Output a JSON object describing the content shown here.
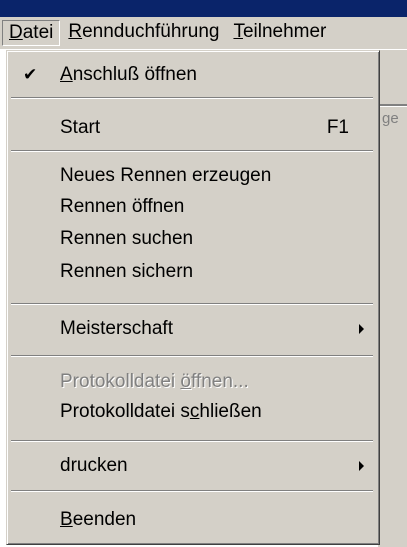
{
  "menubar": {
    "items": [
      {
        "prefix": "",
        "accel": "D",
        "rest": "atei"
      },
      {
        "prefix": "",
        "accel": "R",
        "rest": "ennduchführung"
      },
      {
        "prefix": "",
        "accel": "T",
        "rest": "eilnehmer"
      }
    ]
  },
  "background": {
    "fragment": "ge"
  },
  "menu": {
    "items": [
      {
        "prefix": "",
        "accel": "A",
        "rest": "nschluß öffnen",
        "checked": true
      },
      {
        "label": "Start",
        "shortcut": "F1"
      },
      {
        "label": "Neues Rennen erzeugen"
      },
      {
        "label": "Rennen öffnen"
      },
      {
        "label": "Rennen suchen"
      },
      {
        "label": "Rennen sichern"
      },
      {
        "label": "Meisterschaft",
        "submenu": true
      },
      {
        "prefix": "Protokolldatei ",
        "accel": "ö",
        "rest": "ffnen...",
        "disabled": true
      },
      {
        "prefix": "Protokolldatei s",
        "accel": "c",
        "rest": "hließen"
      },
      {
        "label": "drucken",
        "submenu": true
      },
      {
        "prefix": "",
        "accel": "B",
        "rest": "eenden"
      }
    ]
  }
}
